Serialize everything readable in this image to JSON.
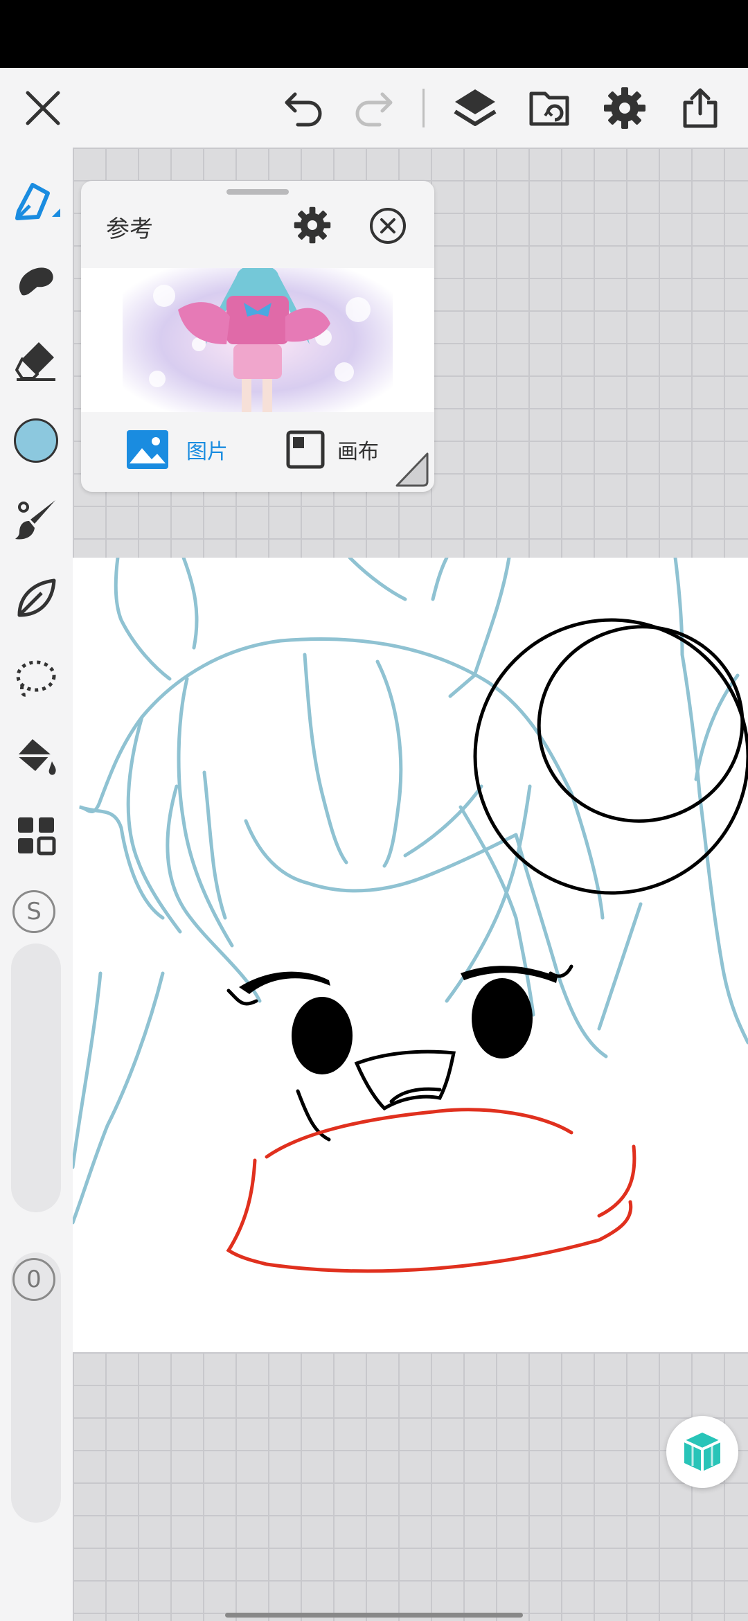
{
  "toolbar": {
    "close_icon": "close-icon",
    "undo_icon": "undo-icon",
    "redo_icon": "redo-icon",
    "layers_icon": "layers-icon",
    "import_icon": "folder-import-icon",
    "settings_icon": "gear-icon",
    "share_icon": "share-icon"
  },
  "tools": [
    "pen",
    "smudge",
    "eraser",
    "color",
    "brush",
    "leaf",
    "lasso",
    "fill",
    "grid"
  ],
  "colors": {
    "accent": "#1a8ce0",
    "current_color": "#8cc8de",
    "sketch_blue": "#8fc2d2",
    "line_black": "#000000",
    "scarf_red": "#e0301e"
  },
  "size_slider": {
    "label": "S"
  },
  "opacity_slider": {
    "label": "0"
  },
  "reference_panel": {
    "title": "参考",
    "tab_image": "图片",
    "tab_canvas": "画布",
    "active_tab": "图片"
  }
}
